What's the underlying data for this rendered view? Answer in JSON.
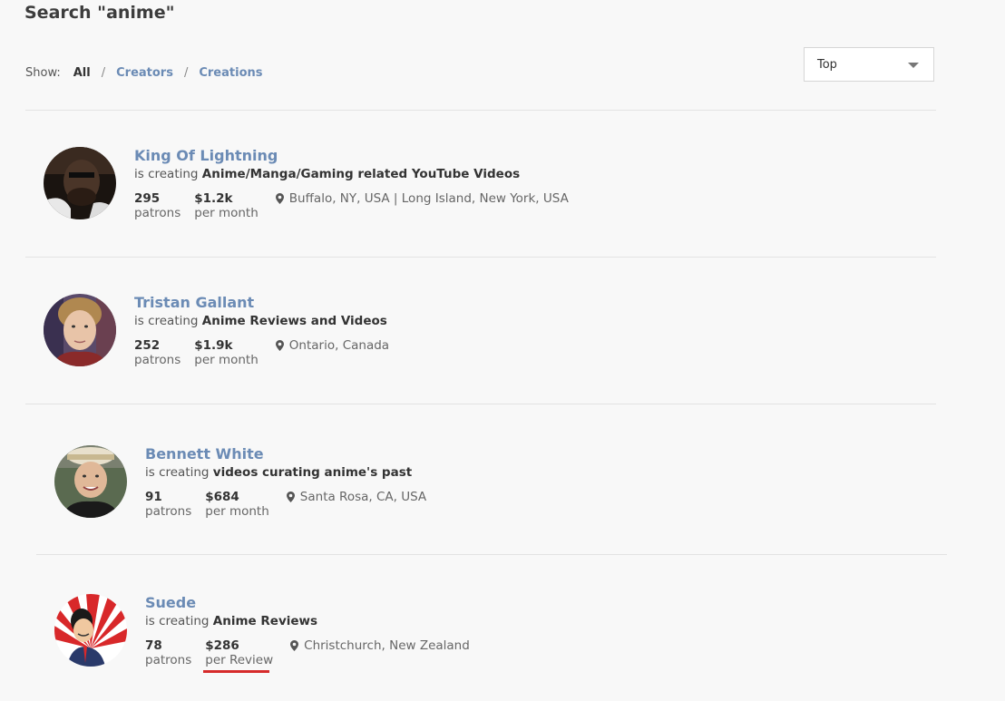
{
  "search": {
    "title": "Search \"anime\""
  },
  "filters": {
    "show_label": "Show:",
    "options": [
      "All",
      "Creators",
      "Creations"
    ],
    "separator": "/"
  },
  "sort": {
    "value": "Top"
  },
  "creators": [
    {
      "name": "King Of Lightning",
      "is_creating": "is creating",
      "creation": "Anime/Manga/Gaming related YouTube Videos",
      "patrons": "295",
      "patrons_label": "patrons",
      "amount": "$1.2k",
      "amount_label": "per month",
      "location": "Buffalo, NY, USA | Long Island, New York, USA"
    },
    {
      "name": "Tristan Gallant",
      "is_creating": "is creating",
      "creation": "Anime Reviews and Videos",
      "patrons": "252",
      "patrons_label": "patrons",
      "amount": "$1.9k",
      "amount_label": "per month",
      "location": "Ontario, Canada"
    },
    {
      "name": "Bennett White",
      "is_creating": "is creating",
      "creation": "videos curating anime's past",
      "patrons": "91",
      "patrons_label": "patrons",
      "amount": "$684",
      "amount_label": "per month",
      "location": "Santa Rosa, CA, USA"
    },
    {
      "name": "Suede",
      "is_creating": "is creating",
      "creation": "Anime Reviews",
      "patrons": "78",
      "patrons_label": "patrons",
      "amount": "$286",
      "amount_label": "per Review",
      "location": "Christchurch, New Zealand"
    }
  ],
  "colors": {
    "link": "#6b8bb5",
    "highlight_underline": "#d62b2b",
    "background": "#f8f8f8"
  }
}
